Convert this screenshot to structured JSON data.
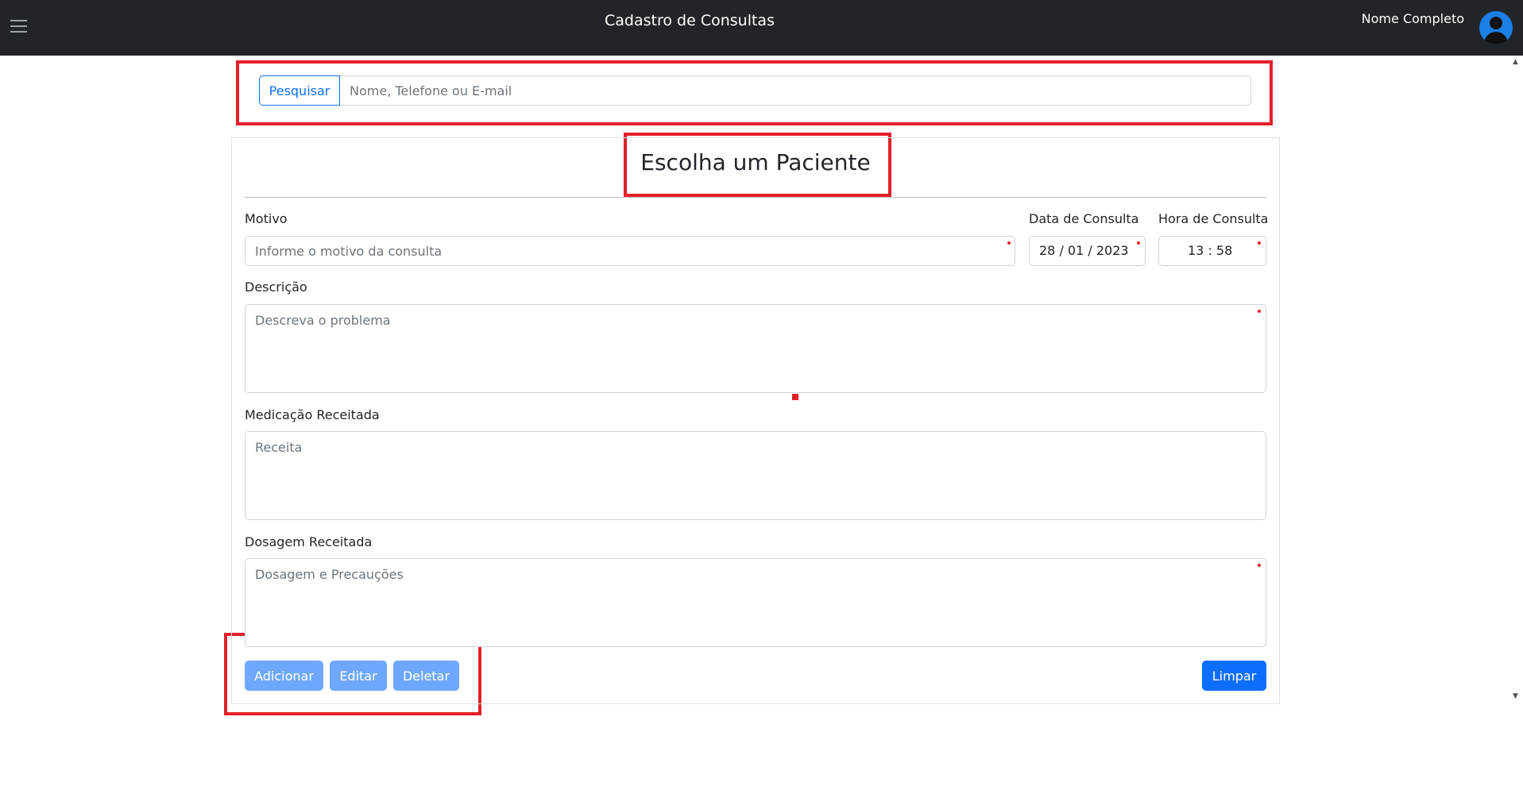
{
  "navbar": {
    "title": "Cadastro de Consultas",
    "user_name": "Nome Completo",
    "menu_icon": "hamburger-icon",
    "avatar_icon": "user-circle-icon",
    "background": "#212529"
  },
  "search": {
    "button_label": "Pesquisar",
    "placeholder": "Nome, Telefone ou E-mail",
    "value": ""
  },
  "form": {
    "title": "Escolha um Paciente",
    "motivo": {
      "label": "Motivo",
      "placeholder": "Informe o motivo da consulta",
      "value": ""
    },
    "data_consulta": {
      "label": "Data de Consulta",
      "value": "28 / 01 / 2023"
    },
    "hora_consulta": {
      "label": "Hora de Consulta",
      "value": "13 : 58"
    },
    "descricao": {
      "label": "Descrição",
      "placeholder": "Descreva o problema",
      "value": ""
    },
    "medicacao": {
      "label": "Medicação Receitada",
      "placeholder": "Receita",
      "value": ""
    },
    "dosagem": {
      "label": "Dosagem Receitada",
      "placeholder": "Dosagem e Precauções",
      "value": ""
    }
  },
  "actions": {
    "adicionar": "Adicionar",
    "editar": "Editar",
    "deletar": "Deletar",
    "limpar": "Limpar"
  },
  "colors": {
    "primary": "#0d6efd",
    "primary_disabled": "#6ea8fe",
    "highlight": "#e3202a"
  }
}
